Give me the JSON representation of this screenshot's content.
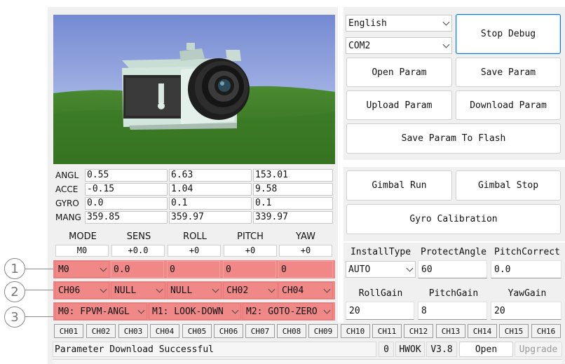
{
  "selects": {
    "language": "English",
    "port": "COM2"
  },
  "buttons": {
    "stop_debug": "Stop Debug",
    "open_param": "Open Param",
    "save_param": "Save Param",
    "upload_param": "Upload Param",
    "download_param": "Download Param",
    "save_flash": "Save Param To Flash",
    "gimbal_run": "Gimbal Run",
    "gimbal_stop": "Gimbal Stop",
    "gyro_calibration": "Gyro Calibration"
  },
  "sensor_table": {
    "rows": [
      {
        "label": "ANGL",
        "values": [
          "0.55",
          "6.63",
          "153.01"
        ]
      },
      {
        "label": "ACCE",
        "values": [
          "-0.15",
          "1.04",
          "9.58"
        ]
      },
      {
        "label": "GYRO",
        "values": [
          "0.0",
          "0.1",
          "0.1"
        ]
      },
      {
        "label": "MANG",
        "values": [
          "359.85",
          "359.97",
          "339.97"
        ]
      }
    ]
  },
  "control": {
    "headers": [
      "MODE",
      "SENS",
      "ROLL",
      "PITCH",
      "YAW"
    ],
    "status_values": [
      "M0",
      "+0.0",
      "+0",
      "+0",
      "+0"
    ],
    "row1": {
      "mode": "M0",
      "sens": "0.0",
      "roll": "0",
      "pitch": "0",
      "yaw": "0"
    },
    "row2": [
      "CH06",
      "NULL",
      "NULL",
      "CH02",
      "CH04"
    ],
    "row3": [
      "M0: FPVM-ANGL",
      "M1: LOOK-DOWN",
      "M2: GOTO-ZERO"
    ],
    "markers": [
      "1",
      "2",
      "3"
    ]
  },
  "settings": {
    "install_type_label": "InstallType",
    "install_type": "AUTO",
    "protect_angle_label": "ProtectAngle",
    "protect_angle": "60",
    "pitch_correct_label": "PitchCorrect",
    "pitch_correct": "0.0",
    "roll_gain_label": "RollGain",
    "roll_gain": "20",
    "pitch_gain_label": "PitchGain",
    "pitch_gain": "8",
    "yaw_gain_label": "YawGain",
    "yaw_gain": "20"
  },
  "channels": [
    "CH01",
    "CH02",
    "CH03",
    "CH04",
    "CH05",
    "CH06",
    "CH07",
    "CH08",
    "CH09",
    "CH10",
    "CH11",
    "CH12",
    "CH13",
    "CH14",
    "CH15",
    "CH16"
  ],
  "status_bar": {
    "message": "Parameter Download Successful",
    "count": "0",
    "hw": "HWOK",
    "version": "V3.8",
    "open": "Open",
    "upgrade": "Upgrade"
  },
  "colors": {
    "accent": "#0078d7",
    "highlight": "#f08888",
    "sky": "#6a7fc8",
    "grass": "#3c7a28"
  }
}
